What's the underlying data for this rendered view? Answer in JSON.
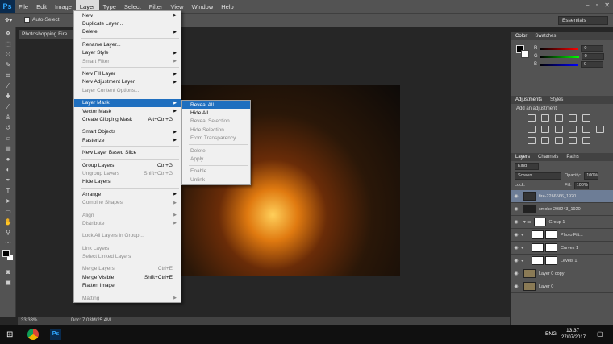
{
  "app_logo": "Ps",
  "menubar": [
    "File",
    "Edit",
    "Image",
    "Layer",
    "Type",
    "Select",
    "Filter",
    "View",
    "Window",
    "Help"
  ],
  "window_controls": [
    "–",
    "▫",
    "✕"
  ],
  "options_bar": {
    "auto_select": "Auto-Select:",
    "workspace": "Essentials"
  },
  "document_tab": "Photoshopping Fire",
  "status": {
    "zoom": "33.33%",
    "doc": "Doc: 7.03M/25.4M"
  },
  "layer_menu": [
    {
      "label": "New",
      "arrow": true
    },
    {
      "label": "Duplicate Layer..."
    },
    {
      "label": "Delete",
      "arrow": true
    },
    {
      "sep": true
    },
    {
      "label": "Rename Layer..."
    },
    {
      "label": "Layer Style",
      "arrow": true
    },
    {
      "label": "Smart Filter",
      "disabled": true,
      "arrow": true
    },
    {
      "sep": true
    },
    {
      "label": "New Fill Layer",
      "arrow": true
    },
    {
      "label": "New Adjustment Layer",
      "arrow": true
    },
    {
      "label": "Layer Content Options...",
      "disabled": true
    },
    {
      "sep": true
    },
    {
      "label": "Layer Mask",
      "arrow": true,
      "highlight": true
    },
    {
      "label": "Vector Mask",
      "arrow": true
    },
    {
      "label": "Create Clipping Mask",
      "shortcut": "Alt+Ctrl+G"
    },
    {
      "sep": true
    },
    {
      "label": "Smart Objects",
      "arrow": true
    },
    {
      "label": "Rasterize",
      "arrow": true
    },
    {
      "sep": true
    },
    {
      "label": "New Layer Based Slice"
    },
    {
      "sep": true
    },
    {
      "label": "Group Layers",
      "shortcut": "Ctrl+G"
    },
    {
      "label": "Ungroup Layers",
      "shortcut": "Shift+Ctrl+G",
      "disabled": true
    },
    {
      "label": "Hide Layers"
    },
    {
      "sep": true
    },
    {
      "label": "Arrange",
      "arrow": true
    },
    {
      "label": "Combine Shapes",
      "arrow": true,
      "disabled": true
    },
    {
      "sep": true
    },
    {
      "label": "Align",
      "arrow": true,
      "disabled": true
    },
    {
      "label": "Distribute",
      "arrow": true,
      "disabled": true
    },
    {
      "sep": true
    },
    {
      "label": "Lock All Layers in Group...",
      "disabled": true
    },
    {
      "sep": true
    },
    {
      "label": "Link Layers",
      "disabled": true
    },
    {
      "label": "Select Linked Layers",
      "disabled": true
    },
    {
      "sep": true
    },
    {
      "label": "Merge Layers",
      "shortcut": "Ctrl+E",
      "disabled": true
    },
    {
      "label": "Merge Visible",
      "shortcut": "Shift+Ctrl+E"
    },
    {
      "label": "Flatten Image"
    },
    {
      "sep": true
    },
    {
      "label": "Matting",
      "arrow": true,
      "disabled": true
    }
  ],
  "submenu": [
    {
      "label": "Reveal All",
      "highlight": true
    },
    {
      "label": "Hide All"
    },
    {
      "label": "Reveal Selection",
      "disabled": true
    },
    {
      "label": "Hide Selection",
      "disabled": true
    },
    {
      "label": "From Transparency",
      "disabled": true
    },
    {
      "sep": true
    },
    {
      "label": "Delete",
      "disabled": true
    },
    {
      "label": "Apply",
      "disabled": true
    },
    {
      "sep": true
    },
    {
      "label": "Enable",
      "disabled": true
    },
    {
      "label": "Unlink",
      "disabled": true
    }
  ],
  "color_panel": {
    "tabs": [
      "Color",
      "Swatches"
    ],
    "values": [
      "0",
      "0",
      "0"
    ]
  },
  "adjustments_panel": {
    "tabs": [
      "Adjustments",
      "Styles"
    ],
    "heading": "Add an adjustment"
  },
  "layers_panel": {
    "tabs": [
      "Layers",
      "Channels",
      "Paths"
    ],
    "kind": "Kind",
    "blend": "Screen",
    "opacity_label": "Opacity:",
    "opacity": "100%",
    "lock_label": "Lock:",
    "fill_label": "Fill:",
    "fill": "100%",
    "layers": [
      {
        "name": "fire-2266566_1920",
        "selected": true
      },
      {
        "name": "smoke-298243_1920"
      },
      {
        "name": "Group 1",
        "group": true
      },
      {
        "name": "Photo Filt...",
        "indent": true,
        "mask": true
      },
      {
        "name": "Curves 1",
        "indent": true,
        "mask": true
      },
      {
        "name": "Levels 1",
        "indent": true,
        "mask": true
      },
      {
        "name": "Layer 0 copy"
      },
      {
        "name": "Layer 0"
      }
    ]
  },
  "taskbar": {
    "lang": "ENG",
    "time": "13:37",
    "date": "27/07/2017"
  },
  "colors": {
    "accent": "#1f6fbf",
    "ui_dark": "#535353",
    "canvas": "#262626"
  }
}
